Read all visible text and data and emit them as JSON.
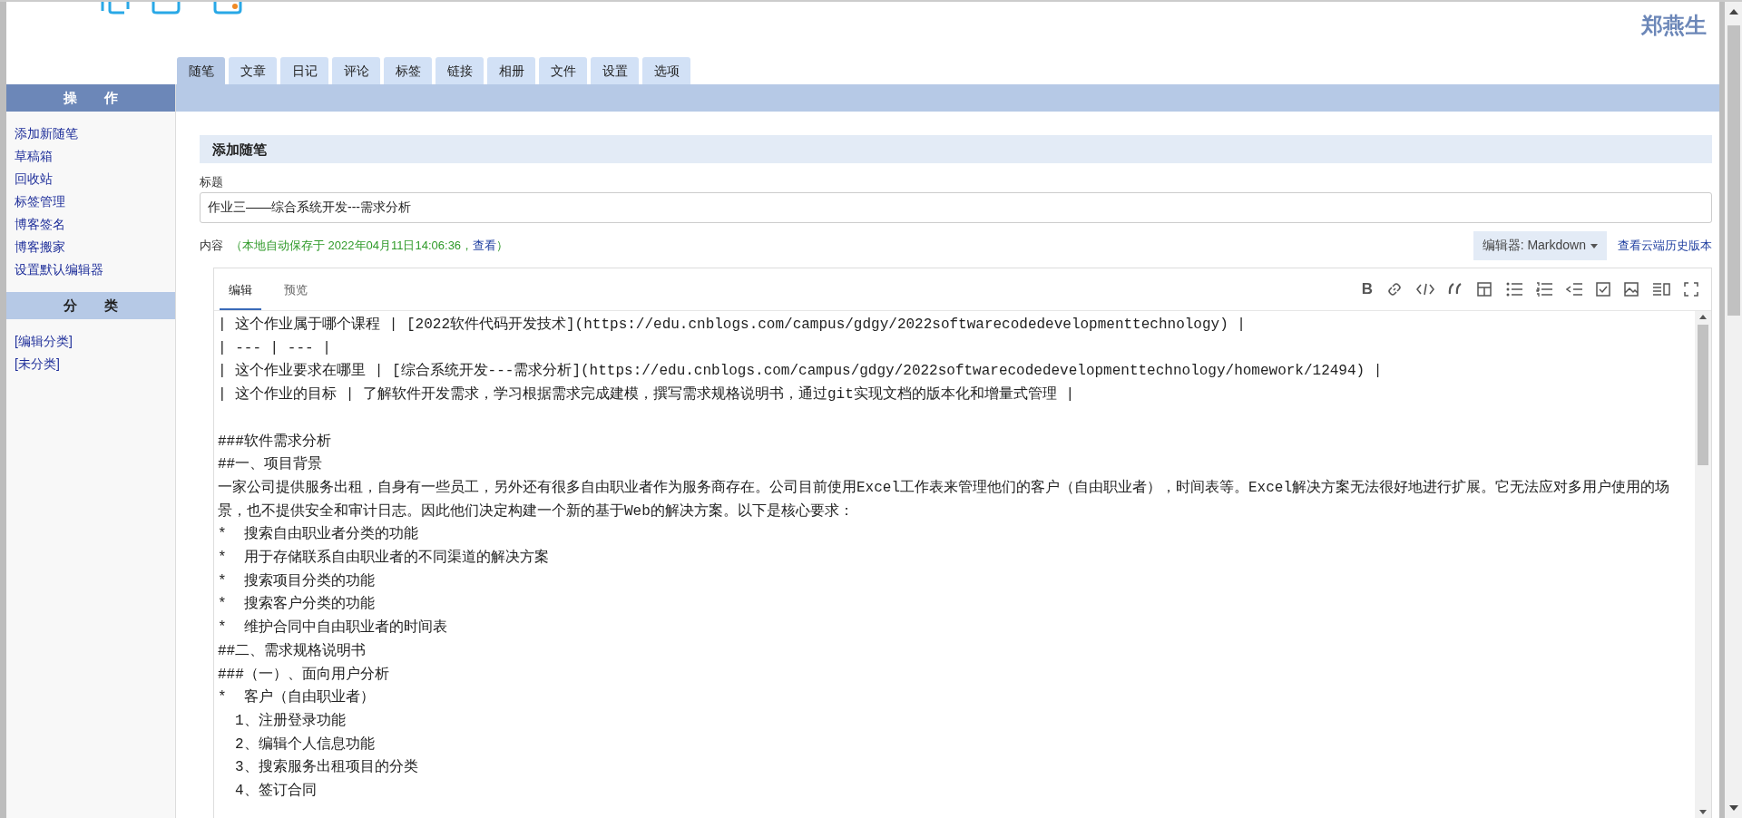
{
  "header": {
    "user_name": "郑燕生"
  },
  "tabs": [
    {
      "label": "随笔",
      "selected": true
    },
    {
      "label": "文章",
      "selected": false
    },
    {
      "label": "日记",
      "selected": false
    },
    {
      "label": "评论",
      "selected": false
    },
    {
      "label": "标签",
      "selected": false
    },
    {
      "label": "链接",
      "selected": false
    },
    {
      "label": "相册",
      "selected": false
    },
    {
      "label": "文件",
      "selected": false
    },
    {
      "label": "设置",
      "selected": false
    },
    {
      "label": "选项",
      "selected": false
    }
  ],
  "sidebar": {
    "sections": [
      {
        "title": "操　　作",
        "kind": "primary",
        "items": [
          "添加新随笔",
          "草稿箱",
          "回收站",
          "标签管理",
          "博客签名",
          "博客搬家",
          "设置默认编辑器"
        ]
      },
      {
        "title": "分　　类",
        "kind": "secondary",
        "items": [
          "[编辑分类]",
          "[未分类]"
        ]
      }
    ]
  },
  "form": {
    "heading": "添加随笔",
    "title_label": "标题",
    "title_value": "作业三——综合系统开发---需求分析",
    "content_label": "内容",
    "autosave_text": "（本地自动保存于 2022年04月11日14:06:36，",
    "autosave_link": "查看",
    "autosave_close": "）",
    "editor_select": "编辑器: Markdown",
    "history_link": "查看云端历史版本"
  },
  "editor": {
    "tabs": [
      {
        "label": "编辑",
        "selected": true
      },
      {
        "label": "预览",
        "selected": false
      }
    ],
    "bold_label": "B",
    "lines": [
      {
        "text": "| 这个作业属于哪个课程 | [2022软件代码开发技术](https://edu.cnblogs.com/campus/gdgy/2022softwarecodedevelopmenttechnology) |",
        "indent": false,
        "gap_before": false
      },
      {
        "text": "| --- | --- |",
        "indent": false,
        "gap_before": false
      },
      {
        "text": "| 这个作业要求在哪里 | [综合系统开发---需求分析](https://edu.cnblogs.com/campus/gdgy/2022softwarecodedevelopmenttechnology/homework/12494) |",
        "indent": false,
        "gap_before": false
      },
      {
        "text": "| 这个作业的目标 | 了解软件开发需求，学习根据需求完成建模，撰写需求规格说明书，通过git实现文档的版本化和增量式管理 |",
        "indent": false,
        "gap_before": false
      },
      {
        "text": "###软件需求分析",
        "indent": false,
        "gap_before": true
      },
      {
        "text": "##一、项目背景",
        "indent": false,
        "gap_before": false
      },
      {
        "text": "一家公司提供服务出租，自身有一些员工，另外还有很多自由职业者作为服务商存在。公司目前使用Excel工作表来管理他们的客户（自由职业者），时间表等。Excel解决方案无法很好地进行扩展。它无法应对多用户使用的场景，也不提供安全和审计日志。因此他们决定构建一个新的基于Web的解决方案。以下是核心要求：",
        "indent": false,
        "gap_before": false
      },
      {
        "text": "*  搜索自由职业者分类的功能",
        "indent": false,
        "gap_before": false
      },
      {
        "text": "*  用于存储联系自由职业者的不同渠道的解决方案",
        "indent": false,
        "gap_before": false
      },
      {
        "text": "*  搜索项目分类的功能",
        "indent": false,
        "gap_before": false
      },
      {
        "text": "*  搜索客户分类的功能",
        "indent": false,
        "gap_before": false
      },
      {
        "text": "*  维护合同中自由职业者的时间表",
        "indent": false,
        "gap_before": false
      },
      {
        "text": "##二、需求规格说明书",
        "indent": false,
        "gap_before": false
      },
      {
        "text": "###（一）、面向用户分析",
        "indent": false,
        "gap_before": false
      },
      {
        "text": "*  客户（自由职业者）",
        "indent": false,
        "gap_before": false
      },
      {
        "text": "1、注册登录功能",
        "indent": true,
        "gap_before": false
      },
      {
        "text": "2、编辑个人信息功能",
        "indent": true,
        "gap_before": false
      },
      {
        "text": "3、搜索服务出租项目的分类",
        "indent": true,
        "gap_before": false
      },
      {
        "text": "4、签订合同",
        "indent": true,
        "gap_before": false
      }
    ]
  }
}
